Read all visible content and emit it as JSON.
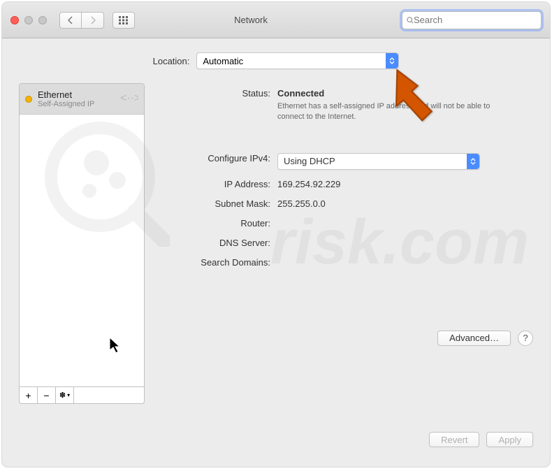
{
  "titlebar": {
    "title": "Network",
    "search_placeholder": "Search"
  },
  "location": {
    "label": "Location:",
    "value": "Automatic"
  },
  "sidebar": {
    "service": {
      "name": "Ethernet",
      "status": "Self-Assigned IP"
    },
    "toolbar": {
      "add": "+",
      "remove": "−",
      "gear": "✽"
    }
  },
  "details": {
    "status_label": "Status:",
    "status_value": "Connected",
    "status_desc": "Ethernet has a self-assigned IP address and will not be able to connect to the Internet.",
    "configure_label": "Configure IPv4:",
    "configure_value": "Using DHCP",
    "ip_label": "IP Address:",
    "ip_value": "169.254.92.229",
    "subnet_label": "Subnet Mask:",
    "subnet_value": "255.255.0.0",
    "router_label": "Router:",
    "router_value": "",
    "dns_label": "DNS Server:",
    "dns_value": "",
    "search_label": "Search Domains:",
    "search_value": ""
  },
  "buttons": {
    "advanced": "Advanced…",
    "help": "?",
    "revert": "Revert",
    "apply": "Apply"
  },
  "watermark": "risk.com"
}
